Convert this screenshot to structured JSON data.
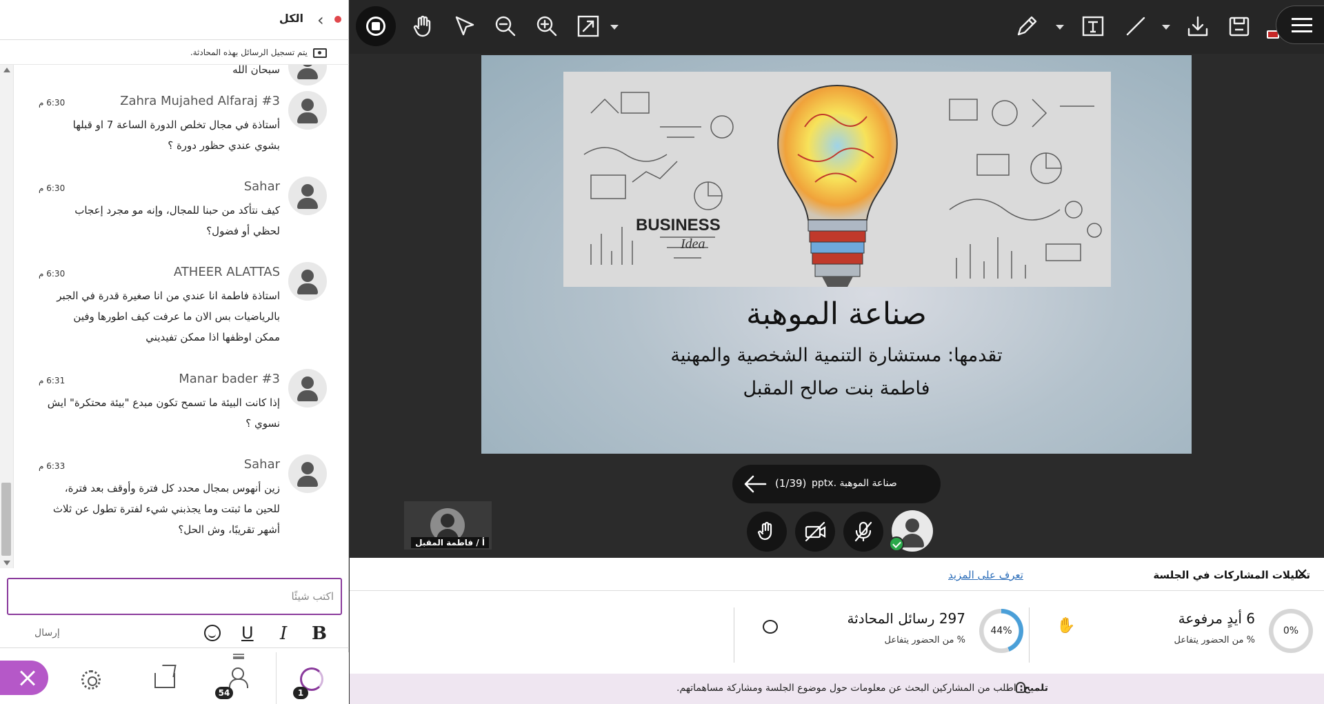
{
  "chat": {
    "header_title": "الكل",
    "recording_notice": "يتم تسجيل الرسائل بهذه المحادثة.",
    "messages": [
      {
        "name": "",
        "time": "",
        "text": "سبحان الله"
      },
      {
        "name": "Zahra Mujahed Alfaraj #3",
        "time": "6:30 م",
        "text": "أستاذة في مجال تخلص الدورة الساعة 7 او قبلها بشوي عندي حظور دورة ؟"
      },
      {
        "name": "Sahar",
        "time": "6:30 م",
        "text": "كيف نتأكد من حبنا للمجال، وإنه مو مجرد إعجاب لحظي أو فضول؟"
      },
      {
        "name": "ATHEER ALATTAS",
        "time": "6:30 م",
        "text": "استاذة فاطمة انا عندي من انا صغيرة قدرة في الجبر بالرياضيات بس الان ما عرفت كيف اطورها وفين ممكن اوظفها اذا ممكن تفيديني"
      },
      {
        "name": "Manar bader #3",
        "time": "6:31 م",
        "text": "إذا كانت البيئة ما تسمح تكون مبدع \"بيئة محتكرة\" ايش نسوي ؟"
      },
      {
        "name": "Sahar",
        "time": "6:33 م",
        "text": "زين أنهوس بمجال محدد كل فترة وأوقف بعد فترة، للحين ما ثبتت وما يجذبني شيء لفترة تطول عن ثلاث أشهر تقريبًا، وش الحل؟"
      }
    ],
    "composer_placeholder": "اكتب شيئًا",
    "send_label": "إرسال",
    "format": {
      "bold": "B",
      "italic": "I",
      "underline": "U"
    },
    "tabs": {
      "people_count": "54",
      "activity_count": "1"
    }
  },
  "toolbar": {
    "icons": [
      "stop-share-icon",
      "hand-icon",
      "pointer-icon",
      "zoom-out-icon",
      "zoom-in-icon",
      "fit-icon",
      "pen-icon",
      "text-icon",
      "line-icon",
      "download-icon",
      "save-icon",
      "menu-icon"
    ]
  },
  "slide": {
    "image_text": "BUSINESS Idea",
    "title": "صناعة الموهبة",
    "subtitle": "تقدمها: مستشارة التنمية الشخصية والمهنية",
    "presenter": "فاطمة بنت صالح المقبل"
  },
  "file": {
    "counter": "(1/39)",
    "name": "صناعة الموهبة .pptx"
  },
  "thumbnail": {
    "label": "أ / فاطمة المقبل"
  },
  "analytics": {
    "title": "تحليلات المشاركات في الجلسة",
    "learn_more": "تعرف على المزيد",
    "stats": [
      {
        "big": "6 أيدٍ مرفوعة",
        "small": "% من الحضور يتفاعل",
        "percent_label": "0%",
        "percent": 0
      },
      {
        "big": "297 رسائل المحادثة",
        "small": "% من الحضور يتفاعل",
        "percent_label": "44%",
        "percent": 44
      }
    ],
    "tip_label": "تلميح:",
    "tip_text": "اطلب من المشاركين البحث عن معلومات حول موضوع الجلسة ومشاركة مساهماتهم."
  },
  "colors": {
    "accent": "#8a3a9c",
    "link": "#2a6cb8",
    "ring": "#4a9fd8",
    "success": "#2aa84a"
  }
}
